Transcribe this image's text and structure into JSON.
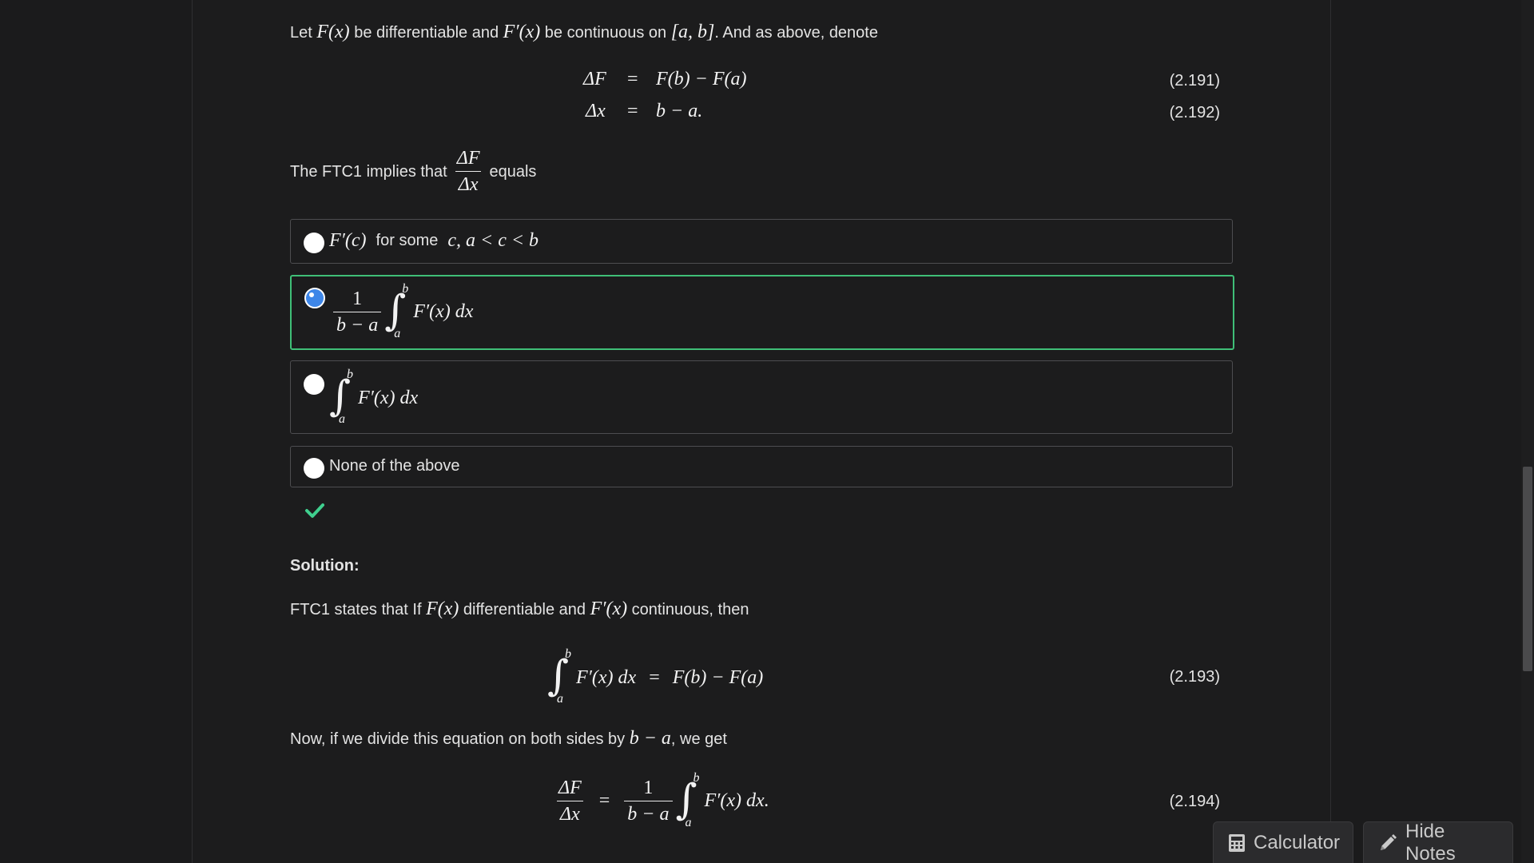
{
  "intro": {
    "let": "Let ",
    "F_of_x": "F(x)",
    "be_diff": " be differentiable and ",
    "Fprime_of_x": "F′(x)",
    "be_cont": " be continuous on ",
    "interval": "[a, b]",
    "rest": ". And as above, denote"
  },
  "equations": [
    {
      "lhs": "ΔF",
      "rhs": "F(b) − F(a)",
      "num": "(2.191)"
    },
    {
      "lhs": "Δx",
      "rhs": "b − a.",
      "num": "(2.192)"
    }
  ],
  "question": {
    "prefix": "The FTC1 implies that",
    "frac_num": "ΔF",
    "frac_den": "Δx",
    "suffix": "equals"
  },
  "options": [
    {
      "math1": "F′(c)",
      "text": "for some",
      "math2": "c,  a < c < b",
      "selected": false
    },
    {
      "frac_num": "1",
      "frac_den": "b − a",
      "upper": "b",
      "lower": "a",
      "integrand": "F′(x) dx",
      "selected": true
    },
    {
      "upper": "b",
      "lower": "a",
      "integrand": "F′(x) dx",
      "selected": false
    },
    {
      "text": "None of the above",
      "selected": false
    }
  ],
  "feedback": {
    "icon": "checkmark-icon",
    "color": "#3fcf8e"
  },
  "solution": {
    "label": "Solution:",
    "line1_a": "FTC1 states that If ",
    "line1_F": "F(x)",
    "line1_b": " differentiable and ",
    "line1_Fp": "F′(x)",
    "line1_c": " continuous, then",
    "eq193": {
      "upper": "b",
      "lower": "a",
      "integrand": "F′(x) dx",
      "rhs": "F(b) − F(a)",
      "num": "(2.193)"
    },
    "line2_a": "Now, if we divide this equation on both sides by ",
    "line2_math": "b − a",
    "line2_b": ", we get",
    "eq194": {
      "lnum": "ΔF",
      "lden": "Δx",
      "rnum": "1",
      "rden": "b − a",
      "upper": "b",
      "lower": "a",
      "integrand": "F′(x) dx.",
      "num": "(2.194)"
    }
  },
  "buttons": {
    "calculator": "Calculator",
    "hide_notes": "Hide Notes"
  }
}
